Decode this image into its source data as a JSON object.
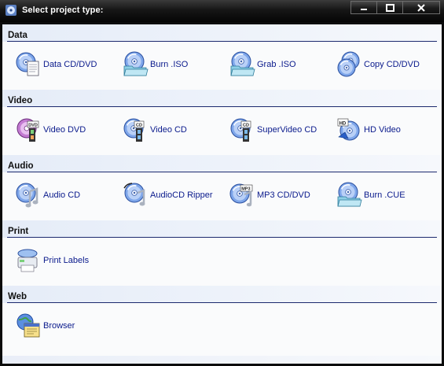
{
  "window": {
    "title": "Select project type:"
  },
  "sections": [
    {
      "label": "Data",
      "items": [
        {
          "label": "Data CD/DVD",
          "icon": "data-disc-document-icon"
        },
        {
          "label": "Burn .ISO",
          "icon": "disc-folder-icon"
        },
        {
          "label": "Grab .ISO",
          "icon": "disc-folder-icon"
        },
        {
          "label": "Copy CD/DVD",
          "icon": "two-discs-icon"
        }
      ]
    },
    {
      "label": "Video",
      "items": [
        {
          "label": "Video DVD",
          "icon": "dvd-film-icon"
        },
        {
          "label": "Video CD",
          "icon": "cd-film-icon"
        },
        {
          "label": "SuperVideo CD",
          "icon": "cd-film-icon"
        },
        {
          "label": "HD Video",
          "icon": "hd-disc-icon"
        }
      ]
    },
    {
      "label": "Audio",
      "items": [
        {
          "label": "Audio CD",
          "icon": "disc-music-note-icon"
        },
        {
          "label": "AudioCD Ripper",
          "icon": "disc-rip-music-icon"
        },
        {
          "label": "MP3 CD/DVD",
          "icon": "mp3-disc-icon"
        },
        {
          "label": "Burn .CUE",
          "icon": "disc-folder-icon"
        }
      ]
    },
    {
      "label": "Print",
      "items": [
        {
          "label": "Print Labels",
          "icon": "printer-disc-icon"
        }
      ]
    },
    {
      "label": "Web",
      "items": [
        {
          "label": "Browser",
          "icon": "globe-browser-icon"
        }
      ]
    }
  ]
}
